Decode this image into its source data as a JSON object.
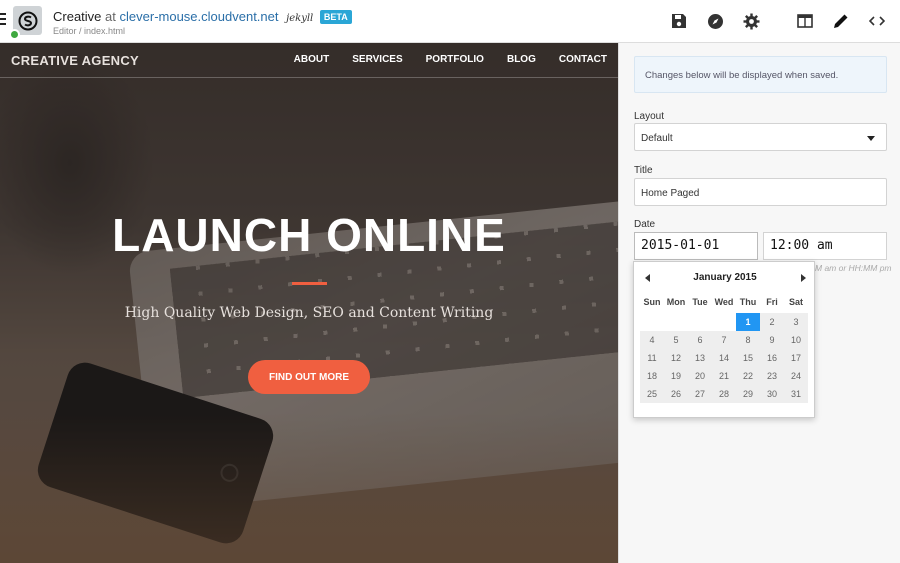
{
  "topbar": {
    "site_name": "Creative",
    "at": "at",
    "domain": "clever-mouse.cloudvent.net",
    "generator": "jekyll",
    "badge": "BETA",
    "breadcrumb": "Editor / index.html"
  },
  "preview": {
    "brand": "CREATIVE AGENCY",
    "nav": [
      "ABOUT",
      "SERVICES",
      "PORTFOLIO",
      "BLOG",
      "CONTACT"
    ],
    "hero_title": "LAUNCH ONLINE",
    "hero_subtitle": "High Quality Web Design, SEO and Content Writing",
    "cta_label": "FIND OUT MORE"
  },
  "panel": {
    "notice": "Changes below will be displayed when saved.",
    "layout_label": "Layout",
    "layout_value": "Default",
    "title_label": "Title",
    "title_value": "Home Paged",
    "date_label": "Date",
    "date_value": "2015-01-01",
    "time_value": "12:00 am",
    "time_hint": "M am or HH:MM pm"
  },
  "calendar": {
    "month": "January",
    "year": "2015",
    "weekdays": [
      "Sun",
      "Mon",
      "Tue",
      "Wed",
      "Thu",
      "Fri",
      "Sat"
    ],
    "leading_blanks": 4,
    "days_in_month": 31,
    "selected_day": 1
  },
  "colors": {
    "accent": "#f05f40",
    "link": "#2b6fa8",
    "beta": "#2aa6d6",
    "selected": "#2196f3"
  }
}
